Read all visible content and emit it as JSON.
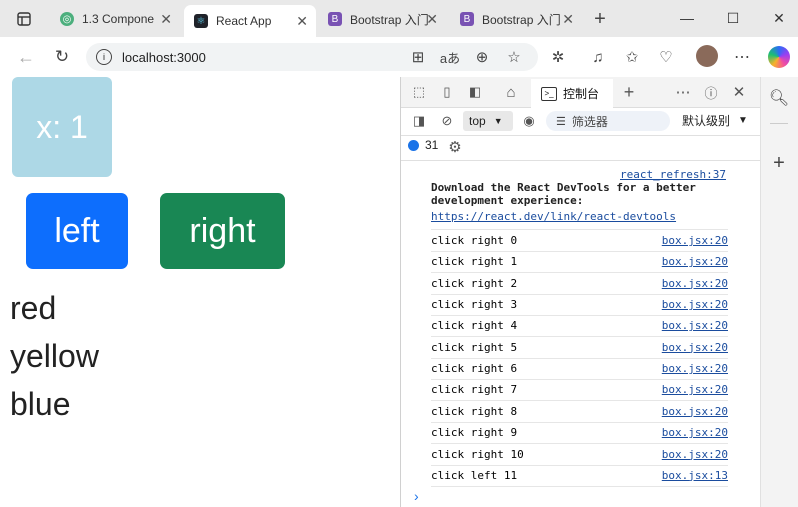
{
  "tabs": [
    {
      "title": "1.3 Compone",
      "icon_color": "#4caf7d"
    },
    {
      "title": "React App",
      "icon_color": "#20232a"
    },
    {
      "title": "Bootstrap 入门",
      "icon_color": "#7952b3"
    },
    {
      "title": "Bootstrap 入门",
      "icon_color": "#7952b3"
    }
  ],
  "address": "localhost:3000",
  "app": {
    "x_label": "x: 1",
    "left_label": "left",
    "right_label": "right",
    "colors": [
      "red",
      "yellow",
      "blue"
    ],
    "box_color": "#add8e6",
    "left_color": "#0d6efd",
    "right_color": "#198754"
  },
  "devtools": {
    "console_tab": "控制台",
    "context": "top",
    "filter_placeholder": "筛选器",
    "level": "默认级别",
    "message_count": "31",
    "react_src": "react_refresh:37",
    "devtools_msg": "Download the React DevTools for a better development experience:",
    "devtools_link": "https://react.dev/link/react-devtools",
    "logs": [
      {
        "text": "click right 0",
        "src": "box.jsx:20"
      },
      {
        "text": "click right 1",
        "src": "box.jsx:20"
      },
      {
        "text": "click right 2",
        "src": "box.jsx:20"
      },
      {
        "text": "click right 3",
        "src": "box.jsx:20"
      },
      {
        "text": "click right 4",
        "src": "box.jsx:20"
      },
      {
        "text": "click right 5",
        "src": "box.jsx:20"
      },
      {
        "text": "click right 6",
        "src": "box.jsx:20"
      },
      {
        "text": "click right 7",
        "src": "box.jsx:20"
      },
      {
        "text": "click right 8",
        "src": "box.jsx:20"
      },
      {
        "text": "click right 9",
        "src": "box.jsx:20"
      },
      {
        "text": "click right 10",
        "src": "box.jsx:20"
      },
      {
        "text": "click left 11",
        "src": "box.jsx:13"
      }
    ]
  }
}
